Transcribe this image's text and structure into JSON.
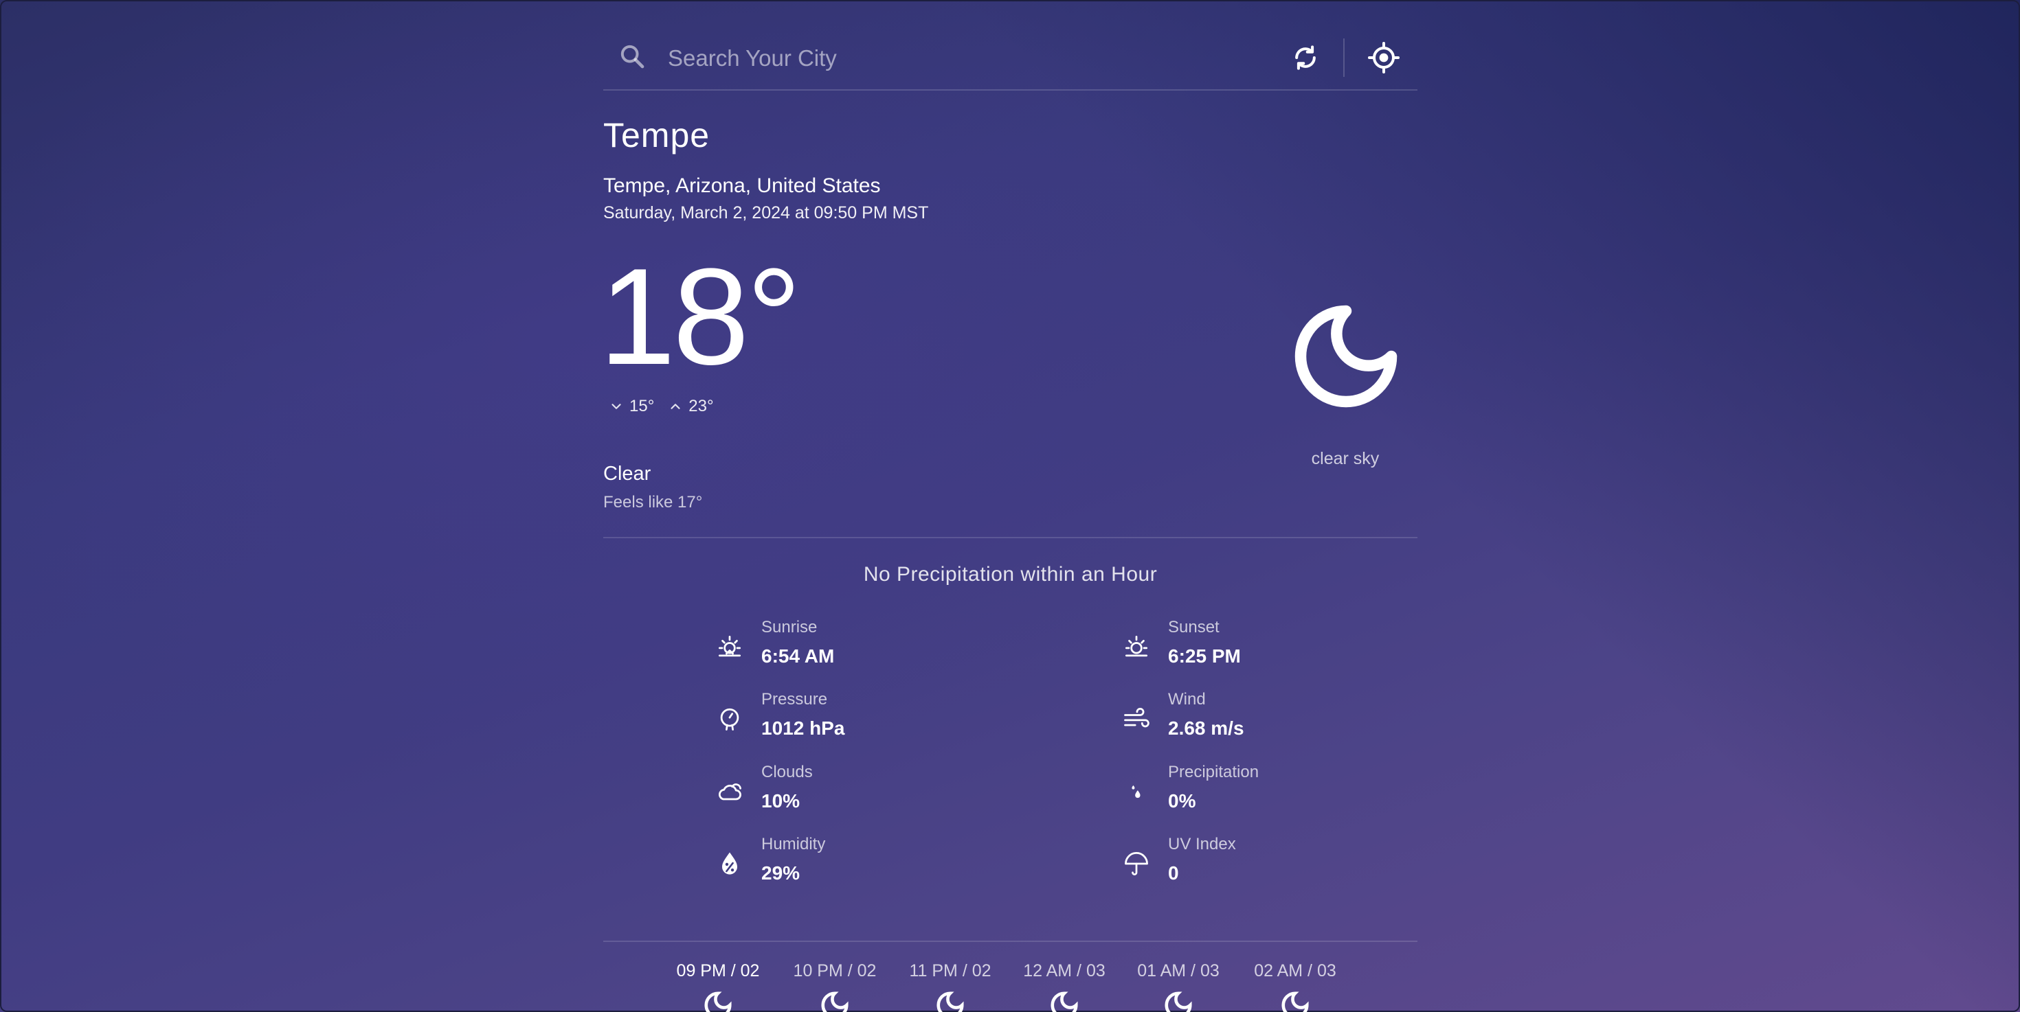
{
  "search": {
    "placeholder": "Search Your City"
  },
  "location": {
    "city": "Tempe",
    "full": "Tempe, Arizona, United States",
    "datetime": "Saturday, March 2, 2024 at 09:50 PM MST"
  },
  "current": {
    "temp": "18°",
    "min": "15°",
    "max": "23°",
    "condition": "Clear",
    "feels_like": "Feels like 17°",
    "icon_name": "moon-icon",
    "icon_desc": "clear sky"
  },
  "precip_message": "No Precipitation within an Hour",
  "stats": [
    {
      "label": "Sunrise",
      "value": "6:54 AM",
      "icon": "sunrise-icon"
    },
    {
      "label": "Sunset",
      "value": "6:25 PM",
      "icon": "sunset-icon"
    },
    {
      "label": "Pressure",
      "value": "1012 hPa",
      "icon": "barometer-icon"
    },
    {
      "label": "Wind",
      "value": "2.68 m/s",
      "icon": "wind-icon"
    },
    {
      "label": "Clouds",
      "value": "10%",
      "icon": "cloud-icon"
    },
    {
      "label": "Precipitation",
      "value": "0%",
      "icon": "raindrops-icon"
    },
    {
      "label": "Humidity",
      "value": "29%",
      "icon": "humidity-icon"
    },
    {
      "label": "UV Index",
      "value": "0",
      "icon": "umbrella-icon"
    }
  ],
  "hourly": [
    {
      "label": "09 PM / 02"
    },
    {
      "label": "10 PM / 02"
    },
    {
      "label": "11 PM / 02"
    },
    {
      "label": "12 AM / 03"
    },
    {
      "label": "01 AM / 03"
    },
    {
      "label": "02 AM / 03"
    }
  ]
}
